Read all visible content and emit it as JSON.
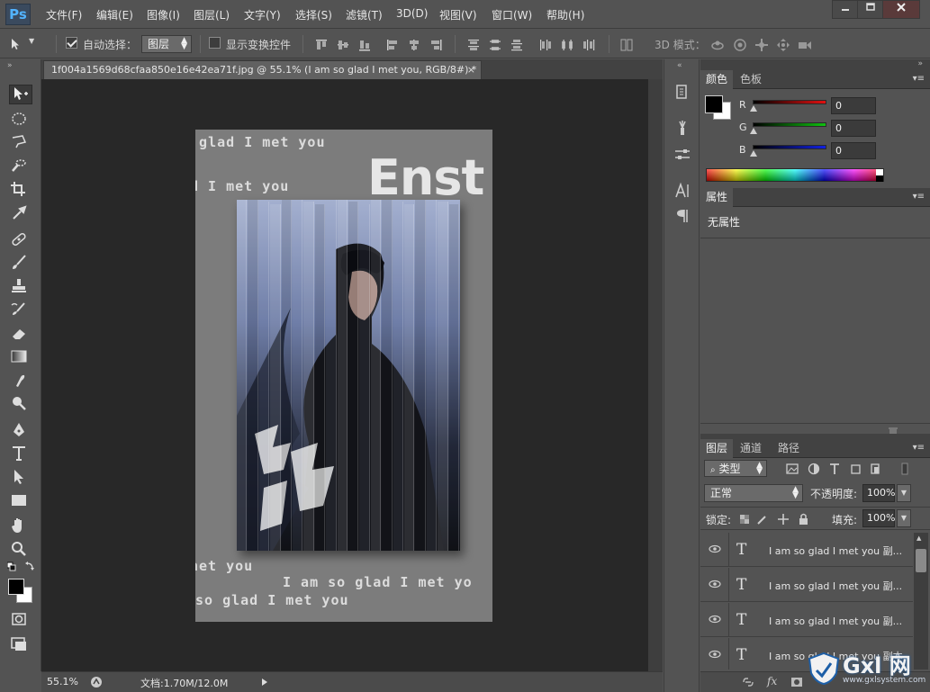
{
  "app": {
    "logo": "Ps",
    "menu": [
      "文件(F)",
      "编辑(E)",
      "图像(I)",
      "图层(L)",
      "文字(Y)",
      "选择(S)",
      "滤镜(T)",
      "3D(D)",
      "视图(V)",
      "窗口(W)",
      "帮助(H)"
    ]
  },
  "options": {
    "auto_select_label": "自动选择：",
    "auto_select_target": "图层",
    "show_transform_label": "显示变换控件",
    "mode3d_label": "3D 模式："
  },
  "document": {
    "tab_title": "1f004a1569d68cfaa850e16e42ea71f.jpg @ 55.1% (I am so glad I met you, RGB/8#) *",
    "close_glyph": "×",
    "poster": {
      "lines": [
        "o glad I met you",
        "d I met you",
        "Enst",
        "net you",
        "I am so glad I met yo",
        "so glad I met you"
      ]
    }
  },
  "status": {
    "zoom": "55.1%",
    "doc_info": "文档:1.70M/12.0M"
  },
  "color_panel": {
    "tabs": [
      "颜色",
      "色板"
    ],
    "channels": [
      {
        "label": "R",
        "value": "0",
        "color": "#e01010"
      },
      {
        "label": "G",
        "value": "0",
        "color": "#10c010"
      },
      {
        "label": "B",
        "value": "0",
        "color": "#1020e0"
      }
    ]
  },
  "properties_panel": {
    "tab": "属性",
    "body": "无属性"
  },
  "layers_panel": {
    "tabs": [
      "图层",
      "通道",
      "路径"
    ],
    "filter_label": "类型",
    "blend_mode": "正常",
    "opacity_label": "不透明度:",
    "opacity_value": "100%",
    "lock_label": "锁定:",
    "fill_label": "填充:",
    "fill_value": "100%",
    "layers": [
      "I am so glad I met you 副...",
      "I am so glad I met you 副...",
      "I am so glad I met you 副...",
      "I am so glad I met you 副本"
    ]
  },
  "watermark": {
    "brand": "Gxl 网",
    "url": "www.gxlsystem.com"
  }
}
